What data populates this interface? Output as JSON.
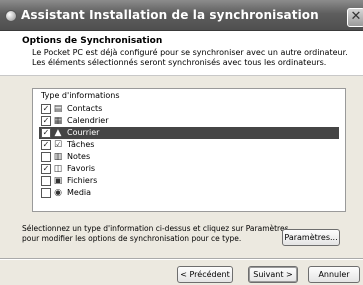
{
  "window": {
    "title": "Assistant Installation de la synchronisation"
  },
  "header": {
    "title": "Options de Synchronisation",
    "line1": "Le Pocket PC est déjà configuré pour se synchroniser avec un autre ordinateur.",
    "line2": "Les éléments sélectionnés seront synchronisés avec tous les ordinateurs."
  },
  "list": {
    "header": "Type d'informations",
    "items": [
      {
        "label": "Contacts",
        "checked": true,
        "icon": "contacts-icon"
      },
      {
        "label": "Calendrier",
        "checked": true,
        "icon": "calendar-icon"
      },
      {
        "label": "Courrier",
        "checked": true,
        "icon": "mail-icon",
        "selected": true
      },
      {
        "label": "Tâches",
        "checked": true,
        "icon": "tasks-icon"
      },
      {
        "label": "Notes",
        "checked": false,
        "icon": "notes-icon"
      },
      {
        "label": "Favoris",
        "checked": true,
        "icon": "favorites-icon"
      },
      {
        "label": "Fichiers",
        "checked": false,
        "icon": "files-icon"
      },
      {
        "label": "Media",
        "checked": false,
        "icon": "media-icon"
      }
    ]
  },
  "description": {
    "line1": "Sélectionnez un type d'information ci-dessus et cliquez sur Paramètres",
    "line2": "pour modifier les options de synchronisation pour ce type."
  },
  "buttons": {
    "settings": "Paramètres...",
    "back": "< Précédent",
    "next": "Suivant >",
    "cancel": "Annuler"
  }
}
